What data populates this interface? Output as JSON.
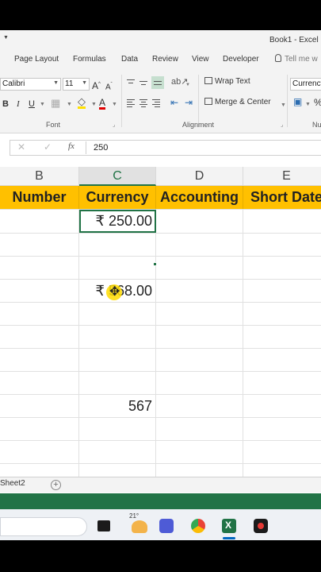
{
  "window": {
    "title": "Book1 - Excel"
  },
  "ribbon_tabs": [
    "Page Layout",
    "Formulas",
    "Data",
    "Review",
    "View",
    "Developer"
  ],
  "tell_me": "Tell me w",
  "font": {
    "name": "Calibri",
    "size": "11"
  },
  "ribbon_labels": {
    "wrap_text": "Wrap Text",
    "merge_center": "Merge & Center",
    "number_format": "Currency",
    "group_font": "Font",
    "group_alignment": "Alignment",
    "group_number": "Nu"
  },
  "formula_bar": {
    "fx": "fx",
    "value": "250"
  },
  "columns": [
    {
      "label": "B",
      "active": false
    },
    {
      "label": "C",
      "active": true
    },
    {
      "label": "D",
      "active": false
    },
    {
      "label": "E",
      "active": false
    }
  ],
  "header_row": {
    "b": "Number",
    "c": "Currency",
    "d": "Accounting",
    "e": "Short Date"
  },
  "cells": {
    "c_row1": "₹ 250.00",
    "c_row4": "₹ 568.00",
    "c_row9": "567"
  },
  "sheet_tabs": {
    "sheet2": "Sheet2",
    "add": "+"
  },
  "taskbar": {
    "weather_temp": "21°"
  },
  "colors": {
    "excel_green": "#217346",
    "header_fill": "#ffc000"
  }
}
